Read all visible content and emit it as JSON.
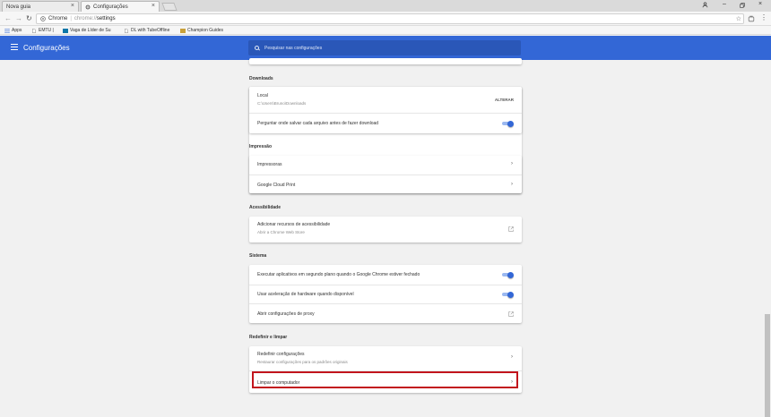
{
  "browser": {
    "tabs": [
      {
        "label": "Nova guia"
      },
      {
        "label": "Configurações"
      }
    ],
    "url": {
      "scheme": "Chrome",
      "separator": "|",
      "host": "chrome://",
      "path": "settings"
    },
    "bookmarks": [
      "Apps",
      "EMTU |",
      "Vaga de Líder de Su",
      "DL with TubeOffline",
      "Champion Guides"
    ]
  },
  "header": {
    "title": "Configurações",
    "search_placeholder": "Pesquisar nas configurações"
  },
  "sections": {
    "downloads": {
      "title": "Downloads",
      "location_label": "Local",
      "location_path": "C:\\Users\\Bruno\\Downloads",
      "change_button": "ALTERAR",
      "ask_label": "Perguntar onde salvar cada arquivo antes de fazer download"
    },
    "printing": {
      "title": "Impressão",
      "printers": "Impressoras",
      "cloud_print": "Google Cloud Print"
    },
    "accessibility": {
      "title": "Acessibilidade",
      "add_label": "Adicionar recursos de acessibilidade",
      "add_sub": "Abrir a Chrome Web Store"
    },
    "system": {
      "title": "Sistema",
      "background_apps": "Executar aplicativos em segundo plano quando o Google Chrome estiver fechado",
      "hardware_accel": "Usar aceleração de hardware quando disponível",
      "proxy": "Abrir configurações de proxy"
    },
    "reset": {
      "title": "Redefinir e limpar",
      "reset_label": "Redefinir configurações",
      "reset_sub": "Restaurar configurações para os padrões originais",
      "cleanup_label": "Limpar o computador"
    }
  },
  "colors": {
    "header": "#3367d6",
    "toggle_on": "#3367d6",
    "highlight": "#c2151d"
  }
}
